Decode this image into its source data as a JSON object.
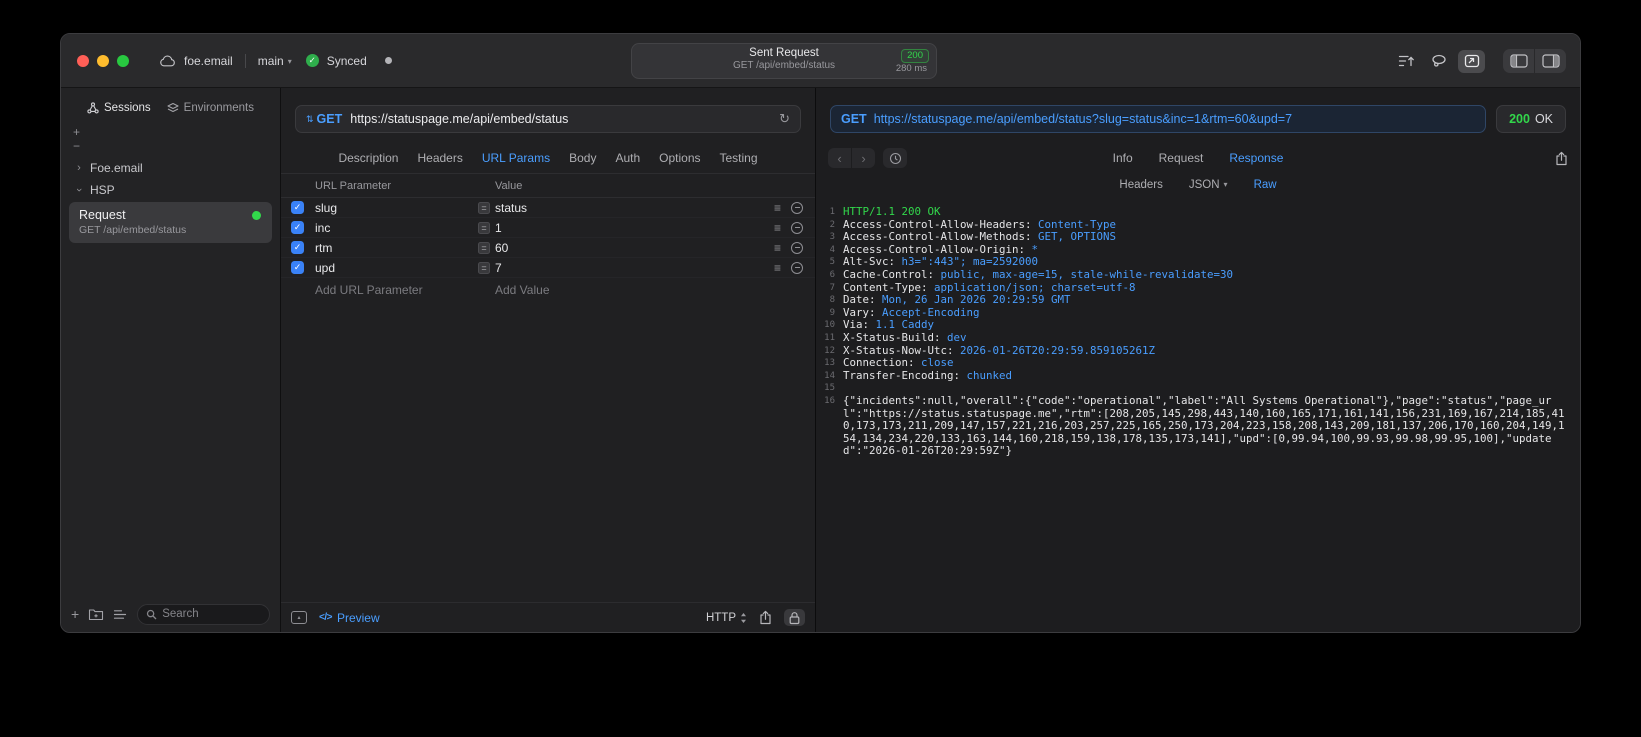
{
  "titlebar": {
    "project": "foe.email",
    "branch": "main",
    "sync_label": "Synced",
    "pill": {
      "title": "Sent Request",
      "status_code": "200",
      "request_line": "GET /api/embed/status",
      "duration": "280 ms"
    }
  },
  "sidebar": {
    "tabs": [
      {
        "label": "Sessions"
      },
      {
        "label": "Environments"
      }
    ],
    "tree": [
      {
        "label": "Foe.email"
      },
      {
        "label": "HSP"
      }
    ],
    "request_item": {
      "title": "Request",
      "subtitle": "GET /api/embed/status"
    },
    "search": {
      "placeholder": "Search"
    }
  },
  "request_editor": {
    "method": "GET",
    "url": "https://statuspage.me/api/embed/status",
    "tabs": [
      {
        "label": "Description"
      },
      {
        "label": "Headers"
      },
      {
        "label": "URL Params"
      },
      {
        "label": "Body"
      },
      {
        "label": "Auth"
      },
      {
        "label": "Options"
      },
      {
        "label": "Testing"
      }
    ],
    "active_tab": "URL Params",
    "params": {
      "columns": {
        "name": "URL Parameter",
        "value": "Value"
      },
      "rows": [
        {
          "name": "slug",
          "value": "status",
          "enabled": true
        },
        {
          "name": "inc",
          "value": "1",
          "enabled": true
        },
        {
          "name": "rtm",
          "value": "60",
          "enabled": true
        },
        {
          "name": "upd",
          "value": "7",
          "enabled": true
        }
      ],
      "add_name": "Add URL Parameter",
      "add_value": "Add Value"
    },
    "footer": {
      "code_glyph": "</>",
      "preview": "Preview",
      "protocol": "HTTP"
    }
  },
  "response_viewer": {
    "method": "GET",
    "url": "https://statuspage.me/api/embed/status?slug=status&inc=1&rtm=60&upd=7",
    "status_code": "200",
    "status_text": "OK",
    "tabs": [
      {
        "label": "Info"
      },
      {
        "label": "Request"
      },
      {
        "label": "Response"
      }
    ],
    "active_tab": "Response",
    "subtabs": [
      {
        "label": "Headers"
      },
      {
        "label": "JSON"
      },
      {
        "label": "Raw"
      }
    ],
    "active_subtab": "Raw",
    "lines": [
      {
        "n": "1",
        "text": "HTTP/1.1 200 OK"
      },
      {
        "n": "2",
        "key": "Access-Control-Allow-Headers: ",
        "value": "Content-Type"
      },
      {
        "n": "3",
        "key": "Access-Control-Allow-Methods: ",
        "value": "GET, OPTIONS"
      },
      {
        "n": "4",
        "key": "Access-Control-Allow-Origin: ",
        "value": "*"
      },
      {
        "n": "5",
        "key": "Alt-Svc: ",
        "value": "h3=\":443\"; ma=2592000"
      },
      {
        "n": "6",
        "key": "Cache-Control: ",
        "value": "public, max-age=15, stale-while-revalidate=30"
      },
      {
        "n": "7",
        "key": "Content-Type: ",
        "value": "application/json; charset=utf-8"
      },
      {
        "n": "8",
        "key": "Date: ",
        "value": "Mon, 26 Jan 2026 20:29:59 GMT"
      },
      {
        "n": "9",
        "key": "Vary: ",
        "value": "Accept-Encoding"
      },
      {
        "n": "10",
        "key": "Via: ",
        "value": "1.1 Caddy"
      },
      {
        "n": "11",
        "key": "X-Status-Build: ",
        "value": "dev"
      },
      {
        "n": "12",
        "key": "X-Status-Now-Utc: ",
        "value": "2026-01-26T20:29:59.859105261Z"
      },
      {
        "n": "13",
        "key": "Connection: ",
        "value": "close"
      },
      {
        "n": "14",
        "key": "Transfer-Encoding: ",
        "value": "chunked"
      },
      {
        "n": "15",
        "key": "",
        "value": ""
      },
      {
        "n": "16",
        "body": "{\"incidents\":null,\"overall\":{\"code\":\"operational\",\"label\":\"All Systems Operational\"},\"page\":\"status\",\"page_url\":\"https://status.statuspage.me\",\"rtm\":[208,205,145,298,443,140,160,165,171,161,141,156,231,169,167,214,185,410,173,173,211,209,147,157,221,216,203,257,225,165,250,173,204,223,158,208,143,209,181,137,206,170,160,204,149,154,134,234,220,133,163,144,160,218,159,138,178,135,173,141],\"upd\":[0,99.94,100,99.93,99.98,99.95,100],\"updated\":\"2026-01-26T20:29:59Z\"}"
      }
    ]
  },
  "icons": {
    "refresh-icon": "↻",
    "method-stepper-icon": "⇅",
    "reorder-handle-icon": "≡",
    "checkbox-check": "✓",
    "back-chevron": "‹",
    "forward-chevron": "›",
    "dropdown-chevron": "▾"
  },
  "colors": {
    "accent": "#4A9EFF",
    "success": "#32D74B",
    "checkbox": "#3A82F7"
  }
}
